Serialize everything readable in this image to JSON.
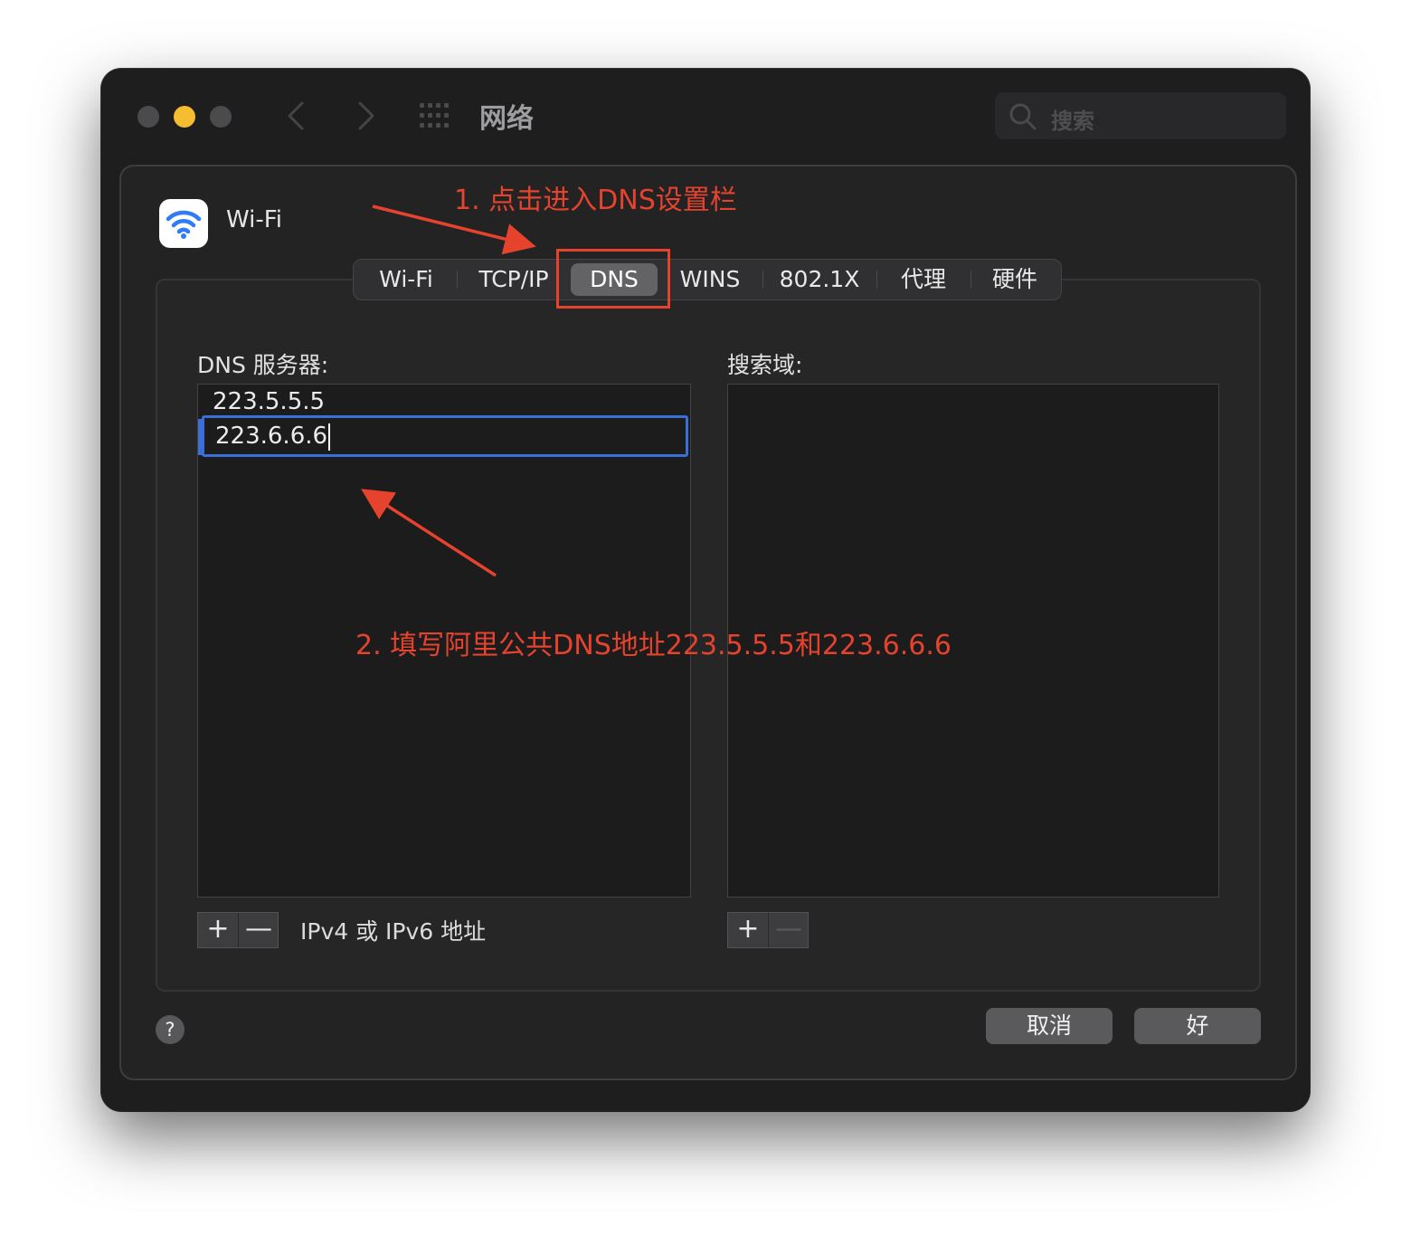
{
  "window": {
    "title": "网络",
    "search_placeholder": "搜索"
  },
  "interface": {
    "name": "Wi-Fi"
  },
  "tabs": [
    {
      "label": "Wi-Fi"
    },
    {
      "label": "TCP/IP"
    },
    {
      "label": "DNS",
      "selected": true
    },
    {
      "label": "WINS"
    },
    {
      "label": "802.1X"
    },
    {
      "label": "代理"
    },
    {
      "label": "硬件"
    }
  ],
  "dns": {
    "servers_label": "DNS 服务器:",
    "servers": [
      "223.5.5.5",
      "223.6.6.6"
    ],
    "search_domains_label": "搜索域:",
    "search_domains": [],
    "hint": "IPv4 或 IPv6 地址",
    "add_symbol": "+",
    "remove_symbol": "—"
  },
  "footer": {
    "help": "?",
    "cancel": "取消",
    "ok": "好"
  },
  "annotations": {
    "step1": "1. 点击进入DNS设置栏",
    "step2": "2. 填写阿里公共DNS地址223.5.5.5和223.6.6.6",
    "color": "#e5432d"
  },
  "colors": {
    "accent_blue": "#3a6fd8",
    "minimize_yellow": "#f5bd2f"
  }
}
